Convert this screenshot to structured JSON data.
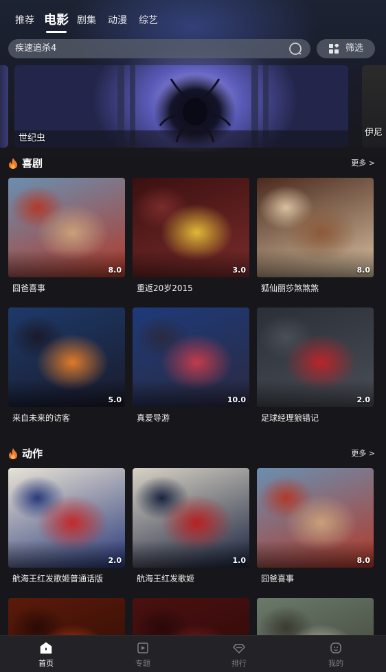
{
  "top_tabs": [
    {
      "label": "推荐",
      "active": false
    },
    {
      "label": "电影",
      "active": true
    },
    {
      "label": "剧集",
      "active": false
    },
    {
      "label": "动漫",
      "active": false
    },
    {
      "label": "综艺",
      "active": false
    }
  ],
  "search": {
    "value": "疾速追杀4",
    "icon": "search-icon"
  },
  "filter": {
    "label": "筛选",
    "icon": "grid-filter-icon"
  },
  "banners": [
    {
      "title": ""
    },
    {
      "title": "世纪虫"
    },
    {
      "title": "伊尼"
    }
  ],
  "sections": [
    {
      "title": "喜剧",
      "more": "更多 >",
      "items": [
        {
          "name": "囧爸喜事",
          "score": "8.0",
          "colors": [
            "#6a8fb0",
            "#c9a07a",
            "#b23a2a"
          ]
        },
        {
          "name": "重返20岁2015",
          "score": "3.0",
          "colors": [
            "#3b1010",
            "#e0b838",
            "#7a2b2b"
          ]
        },
        {
          "name": "狐仙丽莎煞煞煞",
          "score": "8.0",
          "colors": [
            "#4a2a1e",
            "#8c5a3a",
            "#d8c0a0"
          ]
        },
        {
          "name": "来自未来的访客",
          "score": "5.0",
          "colors": [
            "#1d3a6a",
            "#e07a2a",
            "#1a1a2a"
          ]
        },
        {
          "name": "真爱导游",
          "score": "10.0",
          "colors": [
            "#1e3a7a",
            "#c23b4a",
            "#2a2a40"
          ]
        },
        {
          "name": "足球经理狼错记",
          "score": "2.0",
          "colors": [
            "#2a2f38",
            "#b8252a",
            "#4a4e56"
          ]
        }
      ]
    },
    {
      "title": "动作",
      "more": "更多 >",
      "items": [
        {
          "name": "航海王红发歌姬普通话版",
          "score": "2.0",
          "colors": [
            "#e8e2d6",
            "#c22a2a",
            "#2a3a7a"
          ]
        },
        {
          "name": "航海王红发歌姬",
          "score": "1.0",
          "colors": [
            "#d8d2c4",
            "#b82020",
            "#1a2440"
          ]
        },
        {
          "name": "囧爸喜事",
          "score": "8.0",
          "colors": [
            "#6a8fb0",
            "#c9a07a",
            "#b23a2a"
          ]
        },
        {
          "name": "",
          "score": "",
          "colors": [
            "#5a1a0a",
            "#c2401a",
            "#2a0a05"
          ]
        },
        {
          "name": "",
          "score": "",
          "colors": [
            "#4a1010",
            "#8a2020",
            "#2a0808"
          ]
        },
        {
          "name": "",
          "score": "",
          "colors": [
            "#6a7a6a",
            "#c8c8b8",
            "#3a3a30"
          ]
        }
      ]
    }
  ],
  "tabbar": [
    {
      "label": "首页",
      "icon": "home-icon",
      "active": true
    },
    {
      "label": "专题",
      "icon": "play-square-icon",
      "active": false
    },
    {
      "label": "排行",
      "icon": "diamond-icon",
      "active": false
    },
    {
      "label": "我的",
      "icon": "profile-face-icon",
      "active": false
    }
  ]
}
